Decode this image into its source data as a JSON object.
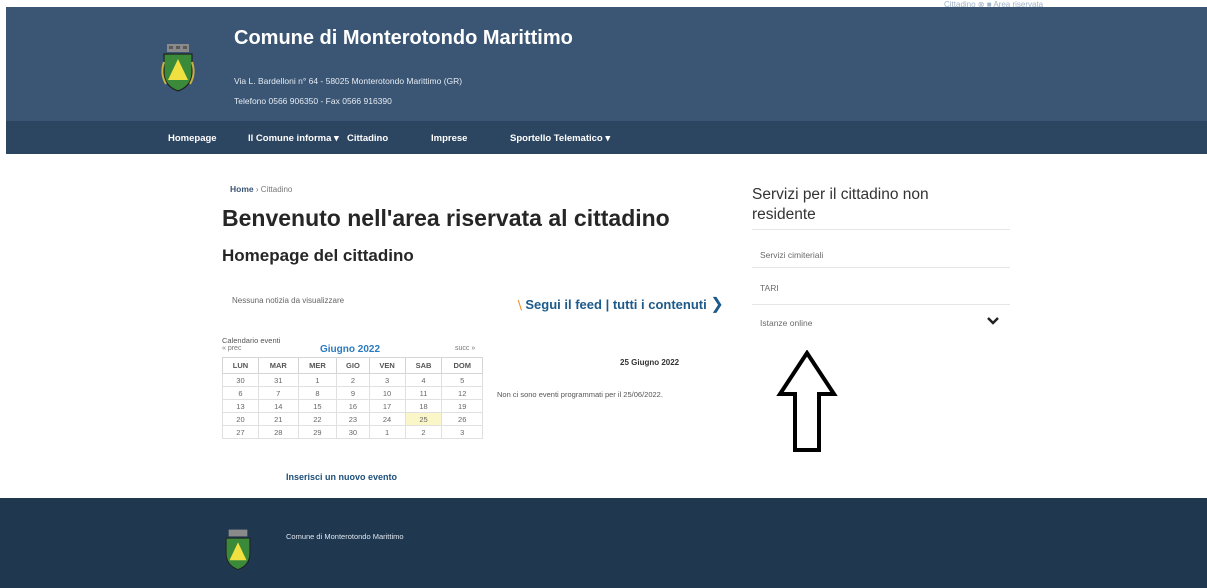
{
  "header": {
    "topright": "Cittadino  ⊗ ■  Area riservata",
    "title": "Comune di Monterotondo Marittimo",
    "address": "Via L. Bardelloni n° 64 - 58025 Monterotondo Marittimo (GR)",
    "phone": "Telefono 0566 906350 - Fax 0566 916390"
  },
  "nav": {
    "homepage": "Homepage",
    "comune_informa": "Il Comune informa ▾",
    "cittadino": "Cittadino",
    "imprese": "Imprese",
    "sportello": "Sportello Telematico ▾"
  },
  "breadcrumb": {
    "home": "Home",
    "sep": "›",
    "current": "Cittadino"
  },
  "main": {
    "title": "Benvenuto nell'area riservata al cittadino",
    "subtitle": "Homepage del cittadino",
    "no_news": "Nessuna notizia da visualizzare",
    "feed_label": "Segui il feed",
    "all_contents": "tutti i contenuti",
    "feed_sep": "|"
  },
  "calendar": {
    "caption": "Calendario eventi",
    "prev": "« prec",
    "month": "Giugno 2022",
    "next": "succ »",
    "days": [
      "LUN",
      "MAR",
      "MER",
      "GIO",
      "VEN",
      "SAB",
      "DOM"
    ],
    "weeks": [
      [
        "30",
        "31",
        "1",
        "2",
        "3",
        "4",
        "5"
      ],
      [
        "6",
        "7",
        "8",
        "9",
        "10",
        "11",
        "12"
      ],
      [
        "13",
        "14",
        "15",
        "16",
        "17",
        "18",
        "19"
      ],
      [
        "20",
        "21",
        "22",
        "23",
        "24",
        "25",
        "26"
      ],
      [
        "27",
        "28",
        "29",
        "30",
        "1",
        "2",
        "3"
      ]
    ],
    "highlighted_day": "25",
    "new_event": "Inserisci un nuovo evento",
    "selected_date": "25 Giugno 2022",
    "no_events": "Non ci sono eventi programmati per il 25/06/2022."
  },
  "sidebar": {
    "title": "Servizi per il cittadino non residente",
    "links": [
      "Servizi cimiteriali",
      "TARI",
      "Istanze online"
    ]
  },
  "footer": {
    "name": "Comune di Monterotondo Marittimo"
  },
  "colors": {
    "header": "#3b5674",
    "nav": "#2c4560",
    "footer": "#1f3850",
    "link": "#1d5a8a",
    "rss": "#f09020",
    "today": "#fbf6c8"
  },
  "icons": {
    "logo": "coat-of-arms-icon",
    "feed": "rss-icon",
    "annotation": "up-arrow-icon"
  }
}
